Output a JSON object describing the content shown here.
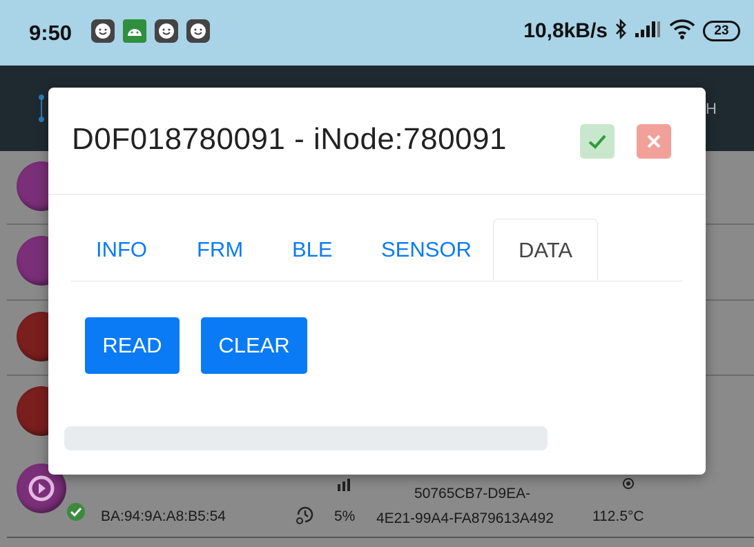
{
  "status_bar": {
    "time": "9:50",
    "net_speed": "10,8kB/s",
    "battery": "23",
    "icons": [
      "smiley-notification-icon",
      "android-debug-icon",
      "smiley-notification-icon",
      "smiley-notification-icon",
      "bluetooth-icon",
      "signal-icon",
      "wifi-icon",
      "battery-icon"
    ]
  },
  "background_app": {
    "toolbar_partial_text": "H",
    "device": {
      "mac": "BA:94:9A:A8:B5:54",
      "battery_pct": "5%",
      "uuid_line1": "50765CB7-D9EA-",
      "uuid_line2": "4E21-99A4-FA879613A492",
      "temperature": "112.5°C"
    }
  },
  "dialog": {
    "title": "D0F018780091 - iNode:780091",
    "tabs": [
      {
        "label": "INFO",
        "active": false
      },
      {
        "label": "FRM",
        "active": false
      },
      {
        "label": "BLE",
        "active": false
      },
      {
        "label": "SENSOR",
        "active": false
      },
      {
        "label": "DATA",
        "active": true
      }
    ],
    "buttons": {
      "read": "READ",
      "clear": "CLEAR"
    },
    "progress": 0
  },
  "colors": {
    "accent": "#0a7bf5",
    "status_bar": "#a9d3e6",
    "ok_button": "#c9e7cc",
    "cancel_button": "#f2a09a"
  }
}
